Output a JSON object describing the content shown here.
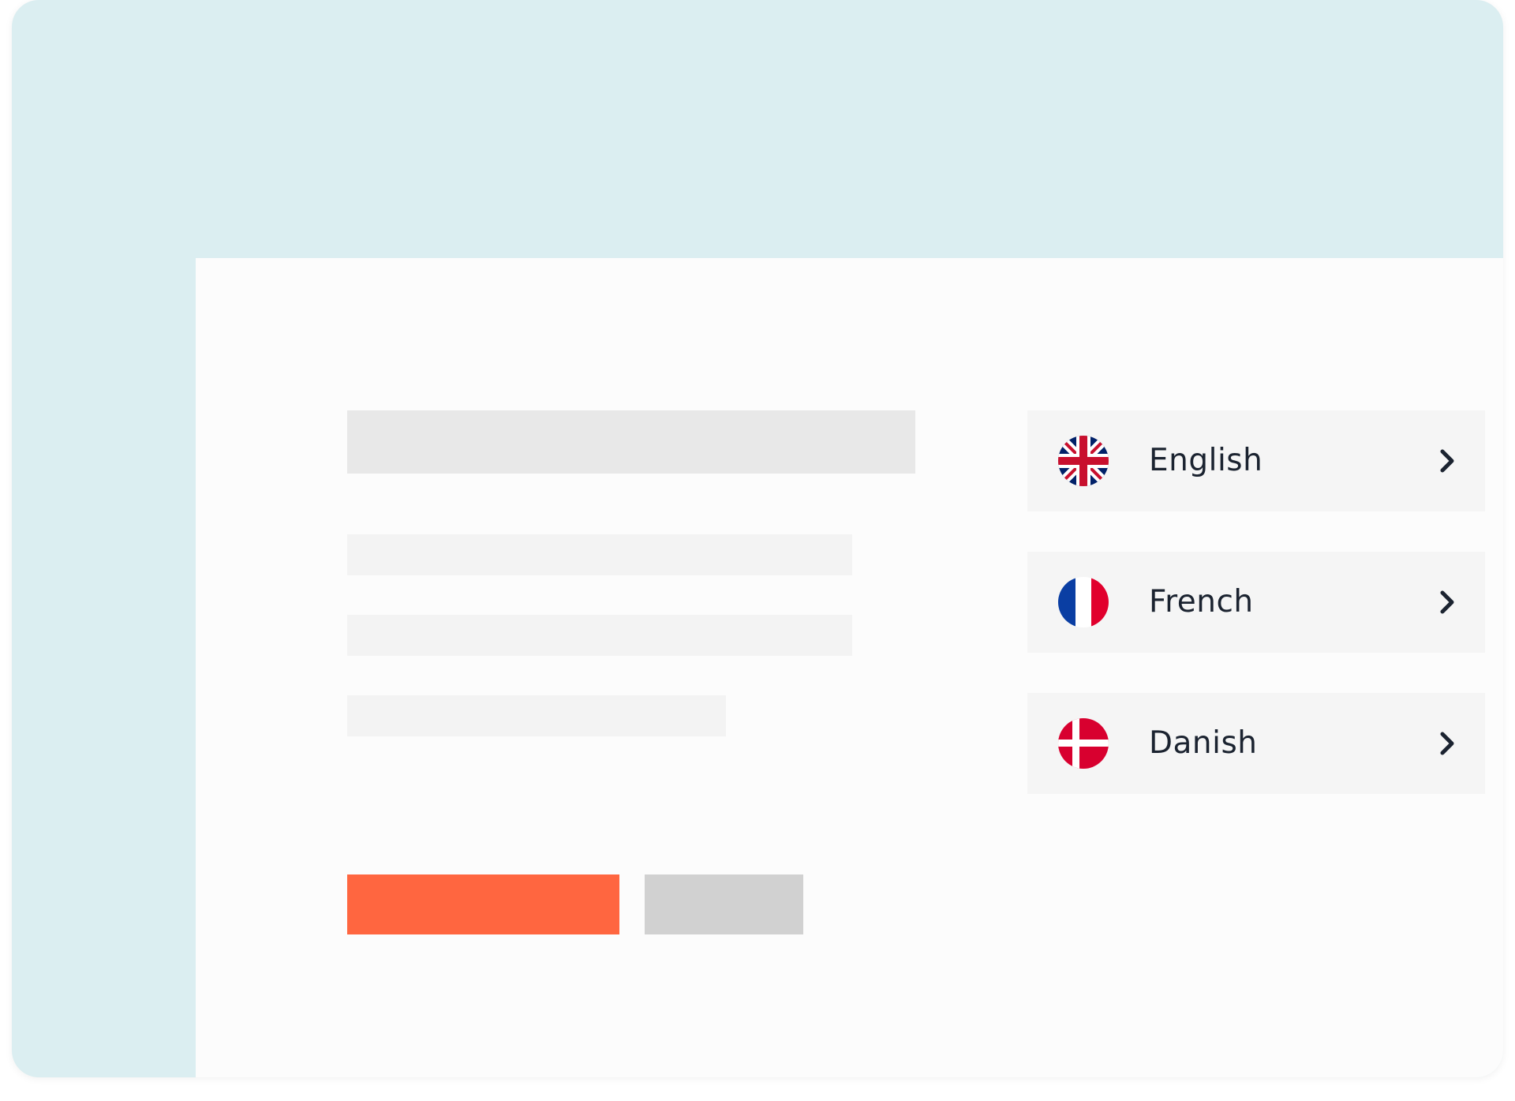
{
  "colors": {
    "frame_bg": "#dbeef1",
    "panel_bg": "#fcfcfc",
    "primary_button": "#ff6640",
    "secondary_button": "#d1d1d1",
    "row_bg": "#f5f5f5",
    "text": "#1b2330"
  },
  "languages": [
    {
      "label": "English",
      "flag_icon": "uk-flag-icon",
      "action_icon": "chevron-right-icon"
    },
    {
      "label": "French",
      "flag_icon": "france-flag-icon",
      "action_icon": "chevron-right-icon"
    },
    {
      "label": "Danish",
      "flag_icon": "denmark-flag-icon",
      "action_icon": "chevron-right-icon"
    }
  ]
}
